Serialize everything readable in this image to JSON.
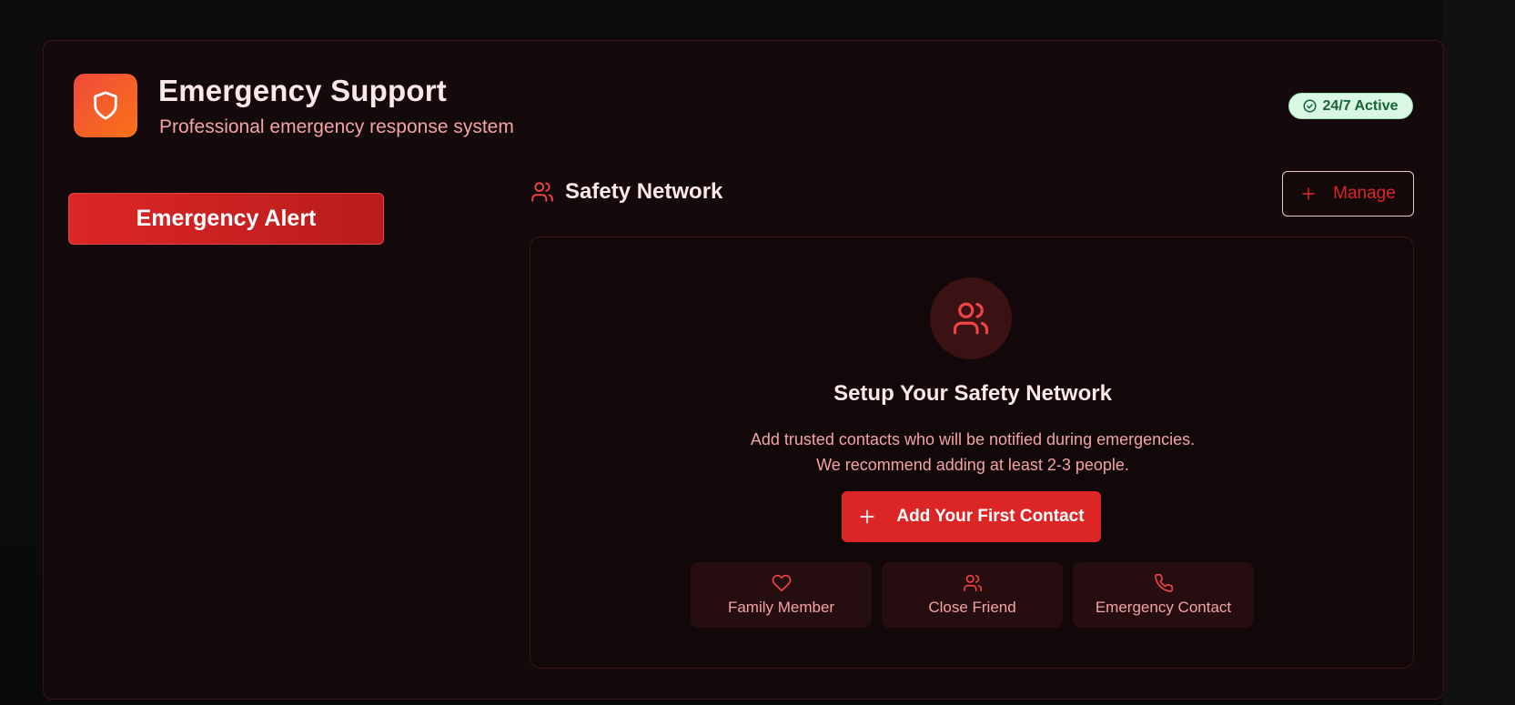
{
  "header": {
    "title": "Emergency Support",
    "subtitle": "Professional emergency response system",
    "status_badge": "24/7 Active",
    "logo_icon": "shield-icon"
  },
  "sidebar": {
    "alert_button": "Emergency Alert"
  },
  "network": {
    "section_title": "Safety Network",
    "manage_button": "Manage",
    "empty_state": {
      "title": "Setup Your Safety Network",
      "description_line1": "Add trusted contacts who will be notified during emergencies.",
      "description_line2": "We recommend adding at least 2-3 people.",
      "add_button": "Add Your First Contact"
    },
    "contact_types": [
      {
        "label": "Family Member",
        "icon": "heart-icon"
      },
      {
        "label": "Close Friend",
        "icon": "users-icon"
      },
      {
        "label": "Emergency Contact",
        "icon": "phone-icon"
      }
    ]
  },
  "colors": {
    "accent": "#dc2626",
    "brand_gradient_start": "#f04a3c",
    "brand_gradient_end": "#f97316",
    "badge_bg": "#d9f7e2",
    "badge_text": "#166534"
  }
}
